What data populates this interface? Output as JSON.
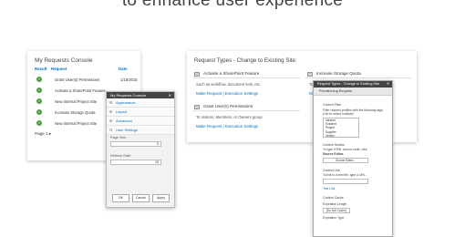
{
  "headline": "to enhance user experience",
  "console": {
    "title": "My Requests Console",
    "headers": {
      "result": "Result",
      "request": "Request",
      "date": "Date"
    },
    "rows": [
      {
        "text": "Grant User(s) Permissions",
        "date": "1/16/2015"
      },
      {
        "text": "Activate a SharePoint Feature",
        "date": ""
      },
      {
        "text": "New Internal Project Site",
        "date": ""
      },
      {
        "text": "Increase Storage Quota",
        "date": ""
      },
      {
        "text": "New Internal Project Site",
        "date": ""
      }
    ],
    "paging": "Page 1",
    "paging_next": "▸"
  },
  "popup": {
    "title": "My Requests Console",
    "close": "✕",
    "items": [
      "Appearance",
      "Layout",
      "Advanced",
      "User Settings"
    ],
    "page_size_label": "Page Size",
    "page_size_value": "5",
    "refresh_label": "Refresh Rate",
    "refresh_value": "15",
    "ok": "OK",
    "cancel": "Cancel",
    "apply": "Apply"
  },
  "request_types": {
    "title": "Request Types - Change to Existing Site:",
    "items": [
      {
        "title": "Activate a SharePoint Feature",
        "desc": "Such as workflow, document sets, etc.",
        "link": "Make Request | Execution Settings"
      },
      {
        "title": "Increase Storage Quota",
        "desc": "To S",
        "link": "Make R"
      },
      {
        "title": "Grant User(s) Permissions",
        "desc": "To Visitors, Members, or Owners group",
        "link": "Make Request | Execution Settings"
      }
    ]
  },
  "tool": {
    "title": "Request Types - Change to Existing Site",
    "close": "✕",
    "section": "Provisioning Request",
    "content_filter": "Content Filter",
    "filter_help": "Filter request profiles with the following tags. (Ctrl to select multiple)",
    "filter_options": [
      "Intranet",
      "Extranet",
      "Project",
      "Supplier",
      "Vendor"
    ],
    "content_section": "Content Section",
    "section_help": "To type HTML source code, click",
    "source_editor": "Source Editor.",
    "source_button": "Source Editor...",
    "content_link": "Content Link",
    "link_help": "To link to a text file, type a URL.",
    "test_link": "Test Link",
    "content_cache": "Content Cache",
    "expiration_length": "Expiration Length",
    "expiration_value": "[Do Not Cache]",
    "expiration_type": "Expiration Type"
  }
}
